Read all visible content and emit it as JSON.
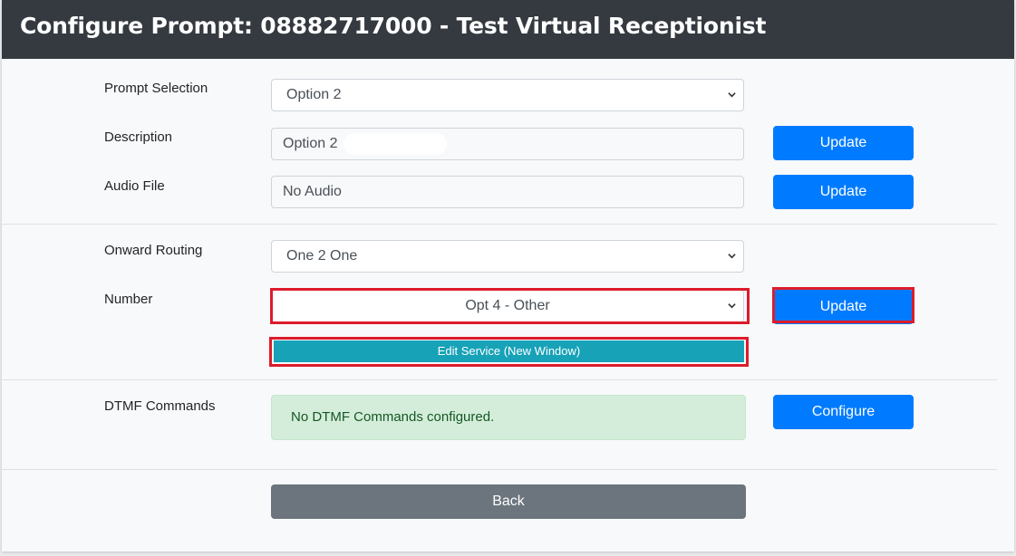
{
  "header": {
    "title": "Configure Prompt: 08882717000 - Test Virtual Receptionist"
  },
  "prompt_selection": {
    "label": "Prompt Selection",
    "value": "Option 2"
  },
  "description": {
    "label": "Description",
    "value": "Option 2",
    "button": "Update"
  },
  "audio_file": {
    "label": "Audio File",
    "value": "No Audio",
    "button": "Update"
  },
  "onward_routing": {
    "label": "Onward Routing",
    "value": "One 2 One"
  },
  "number": {
    "label": "Number",
    "value": "Opt 4 - Other",
    "button": "Update",
    "edit_button": "Edit Service (New Window)"
  },
  "dtmf": {
    "label": "DTMF Commands",
    "message": "No DTMF Commands configured.",
    "button": "Configure"
  },
  "back": {
    "label": "Back"
  },
  "colors": {
    "header": "#343a40",
    "primary": "#007bff",
    "info": "#17a2b8",
    "secondary": "#6c757d",
    "success_bg": "#d4edda",
    "highlight": "#dc1c2b"
  },
  "icons": {
    "select_arrow": "chevron-down-icon"
  }
}
